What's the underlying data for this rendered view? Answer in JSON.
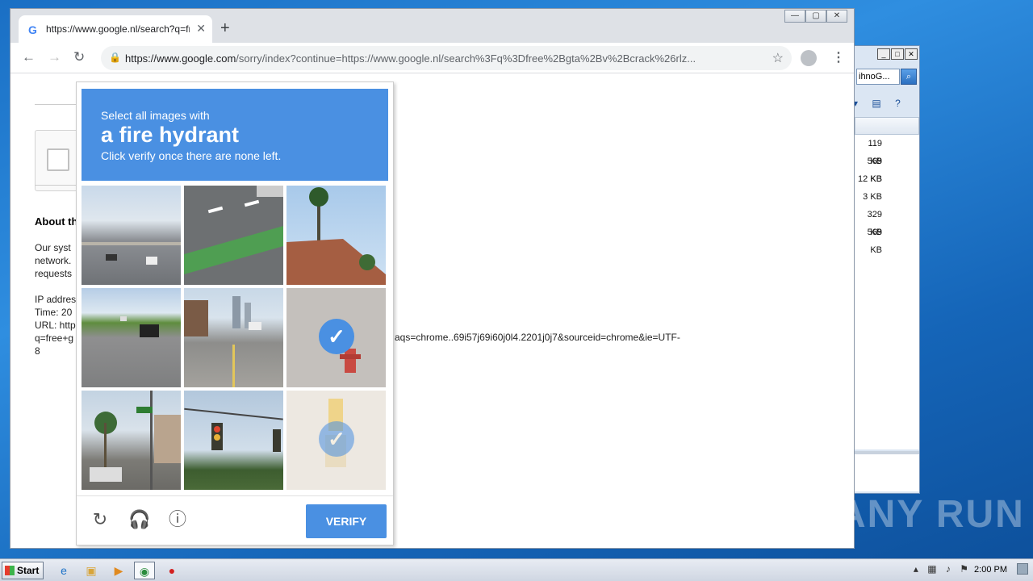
{
  "background_window": {
    "search_value": "ihnoG...",
    "file_sizes": [
      "119 KB",
      "569 KB",
      "12 KB",
      "3 KB",
      "329 KB",
      "569 KB"
    ]
  },
  "browser": {
    "tab_title": "https://www.google.nl/search?q=fr",
    "url_host": "https://www.google.com",
    "url_rest": "/sorry/index?continue=https://www.google.nl/search%3Fq%3Dfree%2Bgta%2Bv%2Bcrack%26rlz..."
  },
  "page": {
    "about_heading": "About th",
    "para_lines": [
      "Our syst",
      "network.",
      "requests"
    ],
    "info_lines": [
      "IP addres",
      "Time: 20",
      "URL: http",
      "q=free+g",
      "8"
    ],
    "url_continuation": "aqs=chrome..69i57j69i60j0l4.2201j0j7&sourceid=chrome&ie=UTF-"
  },
  "captcha": {
    "instruction_line1": "Select all images with",
    "target_object": "a fire hydrant",
    "instruction_line3": "Click verify once there are none left.",
    "verify_label": "VERIFY",
    "tiles": [
      {
        "name": "highway-cars",
        "selected": false
      },
      {
        "name": "green-bike-lane",
        "selected": false
      },
      {
        "name": "palm-tree-roof",
        "selected": false
      },
      {
        "name": "highway-grass",
        "selected": false
      },
      {
        "name": "city-street",
        "selected": false
      },
      {
        "name": "fire-hydrant-gravel",
        "selected": true
      },
      {
        "name": "intersection-palms",
        "selected": false
      },
      {
        "name": "traffic-lights",
        "selected": false
      },
      {
        "name": "fire-hydrant-faded",
        "selected": true
      }
    ]
  },
  "watermark": "ANY RUN",
  "taskbar": {
    "start_label": "Start",
    "clock": "2:00 PM"
  }
}
